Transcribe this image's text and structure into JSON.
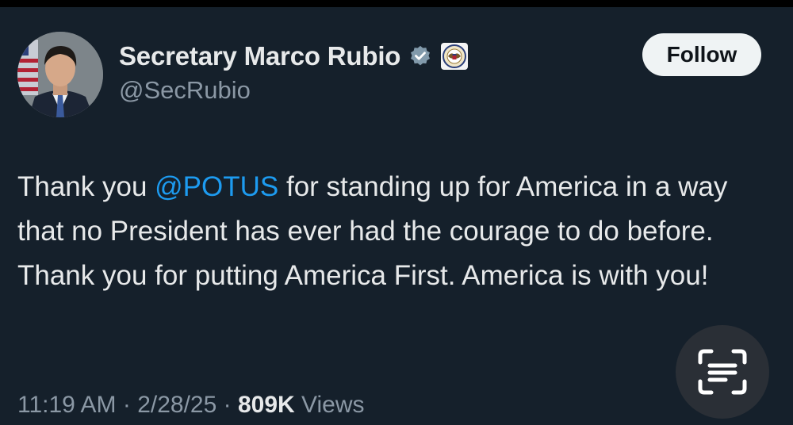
{
  "author": {
    "display_name": "Secretary Marco Rubio",
    "handle": "@SecRubio",
    "verified_badge_icon": "verified-gray-badge-icon",
    "affiliation_icon": "state-department-seal-icon"
  },
  "follow_label": "Follow",
  "tweet": {
    "text_before_mention": "Thank you ",
    "mention": "@POTUS",
    "text_after_mention": " for standing up for America in a way that no President has ever had the courage to do before. Thank you for putting America First. America is with you!"
  },
  "meta": {
    "time": "11:19 AM",
    "date": "2/28/25",
    "separator": " · ",
    "views_count": "809K",
    "views_label": " Views"
  },
  "overlay": {
    "scan_icon": "text-scan-icon"
  },
  "colors": {
    "background": "#15202b",
    "text": "#e7e9ea",
    "muted": "#8b98a5",
    "link": "#1d9bf0",
    "button_bg": "#eff3f4"
  }
}
